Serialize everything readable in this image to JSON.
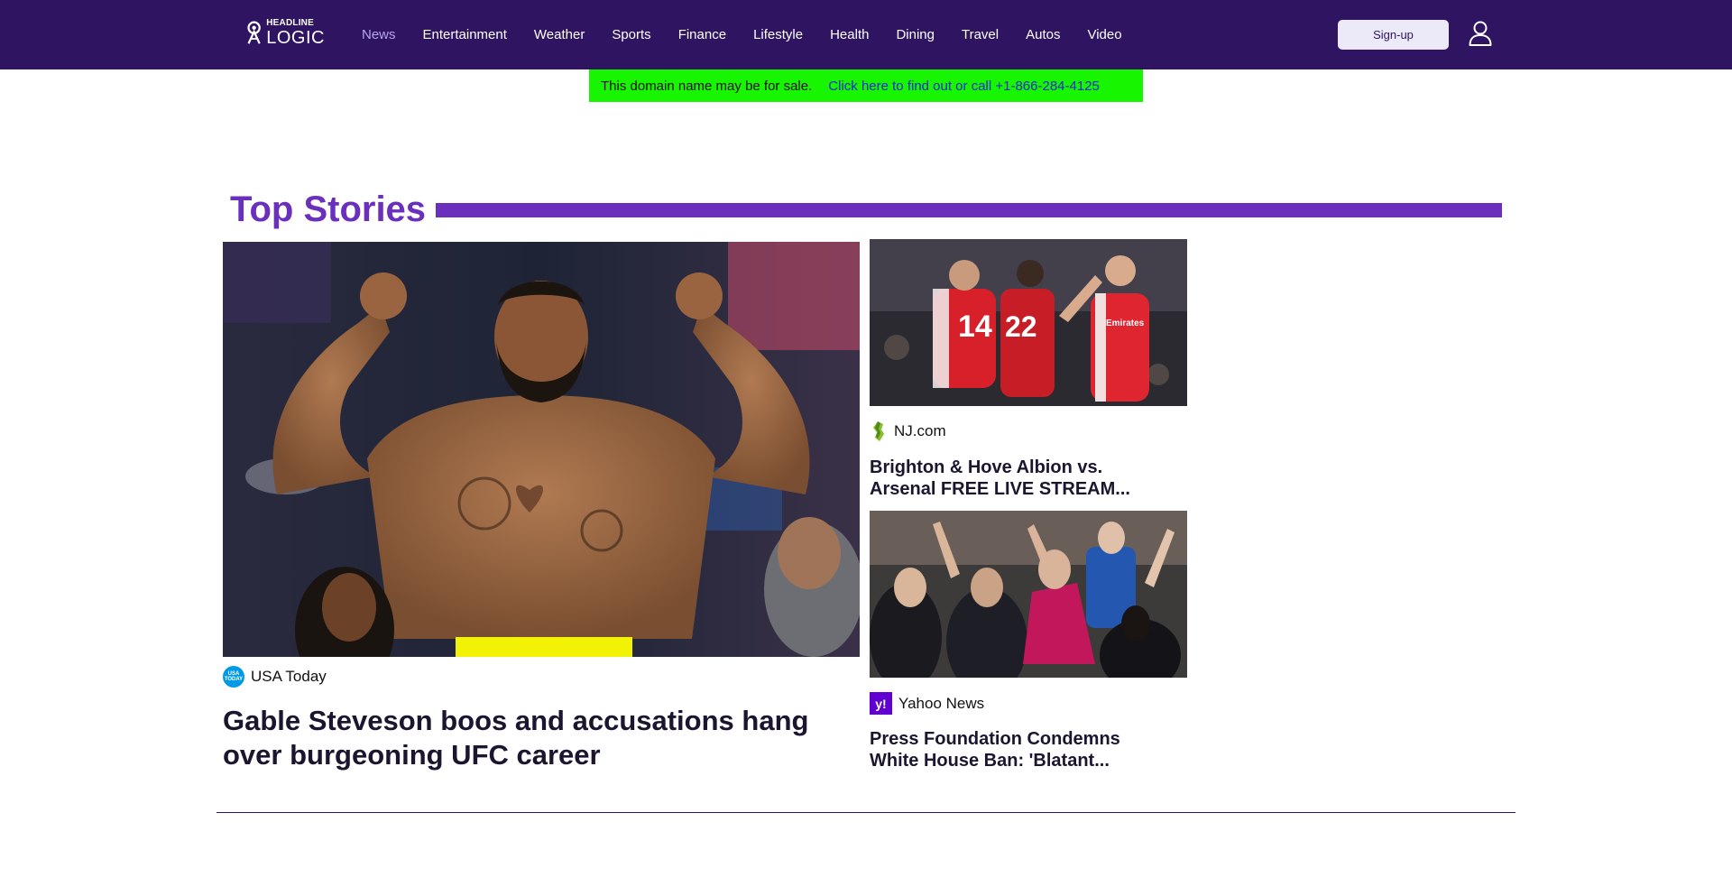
{
  "header": {
    "logo": {
      "line1": "HEADLINE",
      "line2": "LOGIC"
    },
    "nav": [
      {
        "label": "News",
        "active": true
      },
      {
        "label": "Entertainment"
      },
      {
        "label": "Weather"
      },
      {
        "label": "Sports"
      },
      {
        "label": "Finance"
      },
      {
        "label": "Lifestyle"
      },
      {
        "label": "Health"
      },
      {
        "label": "Dining"
      },
      {
        "label": "Travel"
      },
      {
        "label": "Autos"
      },
      {
        "label": "Video"
      }
    ],
    "signup_label": "Sign-up",
    "user_icon": "user-icon"
  },
  "domain_banner": {
    "message": "This domain name may be for sale.",
    "link": "Click here to find out or call +1-866-284-4125"
  },
  "top_stories": {
    "title": "Top Stories",
    "main": {
      "source": "USA Today",
      "source_logo": "USA TODAY",
      "headline": "Gable Steveson boos and accusations hang over burgeoning UFC career"
    },
    "side": [
      {
        "source": "NJ.com",
        "headline": "Brighton & Hove Albion vs. Arsenal FREE LIVE STREAM..."
      },
      {
        "source": "Yahoo News",
        "source_logo": "y!",
        "headline": "Press Foundation Condemns White House Ban: 'Blatant..."
      }
    ]
  },
  "colors": {
    "header_bg": "#2e1461",
    "accent": "#6b2fbd",
    "nav_active": "#b9a4ee",
    "banner_bg": "#17f500",
    "banner_link": "#1a2bd0"
  }
}
